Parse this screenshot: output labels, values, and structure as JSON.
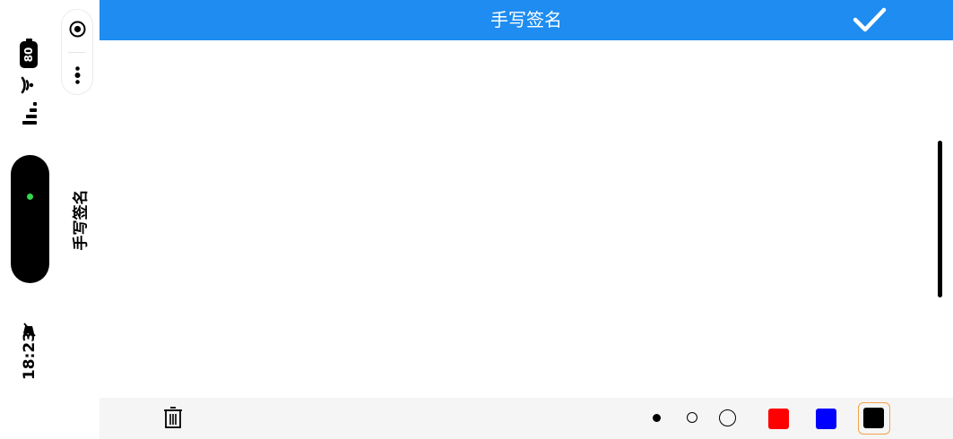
{
  "status": {
    "time": "18:23",
    "battery": "80"
  },
  "capsule": {
    "more_icon": "more-dots-icon",
    "target_icon": "target-icon"
  },
  "page": {
    "vertical_title": "手写签名",
    "title": "手写签名"
  },
  "toolbar": {
    "clear_icon": "trash-icon",
    "pen_sizes": [
      "small",
      "medium",
      "large"
    ],
    "colors": [
      "#ff0000",
      "#0000ff",
      "#000000"
    ],
    "selected_color": "#000000",
    "selected_border": "#f3a24a"
  },
  "theme": {
    "nav_bg": "#1e8cf0",
    "toolbar_bg": "#f5f5f5"
  }
}
